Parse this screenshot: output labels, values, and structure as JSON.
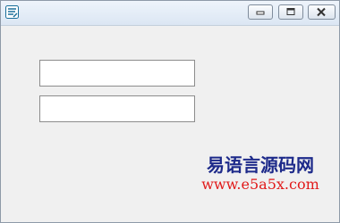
{
  "window": {
    "title": "",
    "controls": {
      "minimize_icon": "minimize-icon",
      "maximize_icon": "maximize-icon",
      "close_icon": "close-icon"
    }
  },
  "form": {
    "textbox1": {
      "value": ""
    },
    "textbox2": {
      "value": ""
    }
  },
  "watermark": {
    "site_name": "易语言源码网",
    "url": "www.e5a5x.com"
  },
  "colors": {
    "watermark_name": "#1d2a8a",
    "watermark_url": "#e11a1a",
    "window_bg": "#f0f0f0"
  }
}
